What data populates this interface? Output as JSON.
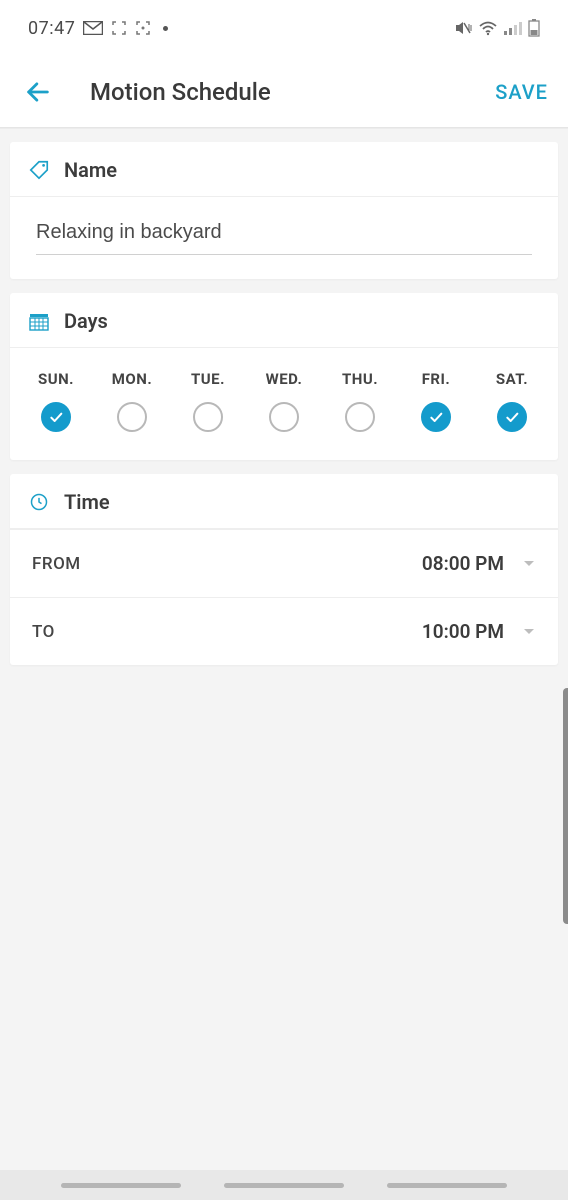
{
  "status_bar": {
    "time": "07:47"
  },
  "app_bar": {
    "title": "Motion Schedule",
    "save_label": "SAVE"
  },
  "name_section": {
    "header": "Name",
    "value": "Relaxing in backyard"
  },
  "days_section": {
    "header": "Days",
    "days": [
      {
        "label": "SUN.",
        "checked": true
      },
      {
        "label": "MON.",
        "checked": false
      },
      {
        "label": "TUE.",
        "checked": false
      },
      {
        "label": "WED.",
        "checked": false
      },
      {
        "label": "THU.",
        "checked": false
      },
      {
        "label": "FRI.",
        "checked": true
      },
      {
        "label": "SAT.",
        "checked": true
      }
    ]
  },
  "time_section": {
    "header": "Time",
    "from_label": "FROM",
    "from_value": "08:00 PM",
    "to_label": "TO",
    "to_value": "10:00 PM"
  },
  "colors": {
    "accent": "#149bcc",
    "save": "#1ca0c8"
  }
}
